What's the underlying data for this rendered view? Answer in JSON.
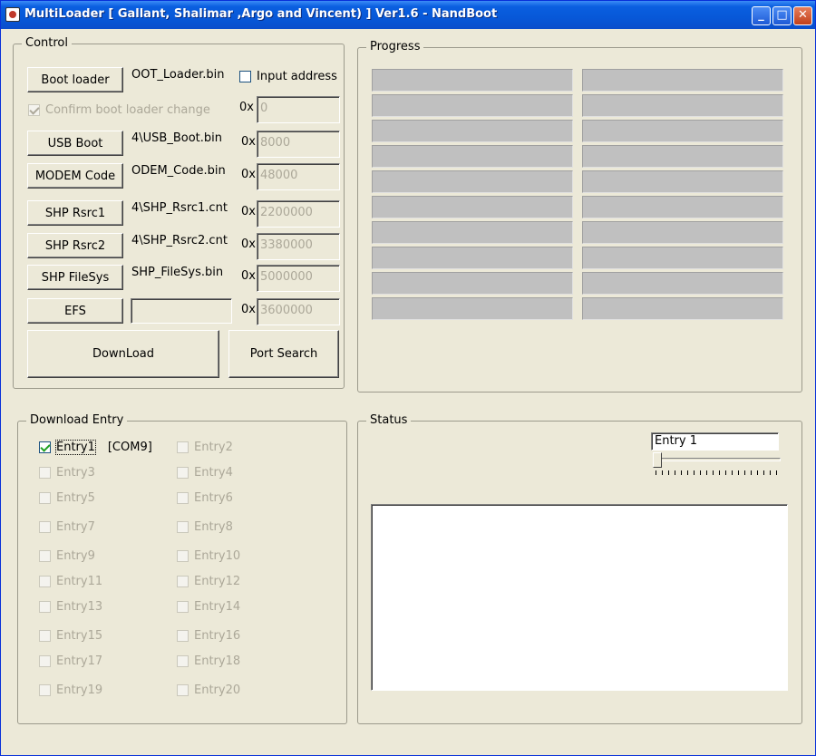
{
  "window": {
    "title": "MultiLoader [ Gallant, Shalimar ,Argo and Vincent) ] Ver1.6 - NandBoot",
    "minimize": "_",
    "maximize": "□",
    "close": "✕"
  },
  "control": {
    "label": "Control",
    "input_address_label": "Input address",
    "confirm_label": "Confirm boot loader change",
    "hex_prefix": "0x",
    "rows": [
      {
        "button": "Boot loader",
        "file": "OOT_Loader.bin",
        "addr": "0"
      },
      {
        "button": "USB Boot",
        "file": "4\\USB_Boot.bin",
        "addr": "8000"
      },
      {
        "button": "MODEM Code",
        "file": "ODEM_Code.bin",
        "addr": "48000"
      },
      {
        "button": "SHP Rsrc1",
        "file": "4\\SHP_Rsrc1.cnt",
        "addr": "2200000"
      },
      {
        "button": "SHP Rsrc2",
        "file": "4\\SHP_Rsrc2.cnt",
        "addr": "3380000"
      },
      {
        "button": "SHP FileSys",
        "file": "SHP_FileSys.bin",
        "addr": "5000000"
      },
      {
        "button": "EFS",
        "file": "",
        "addr": "3600000"
      }
    ],
    "download_label": "DownLoad",
    "port_search_label": "Port Search"
  },
  "progress": {
    "label": "Progress",
    "bar_count": 20
  },
  "download_entry": {
    "label": "Download Entry",
    "entries": [
      {
        "label": "Entry1",
        "port": "[COM9]",
        "checked": true,
        "enabled": true
      },
      {
        "label": "Entry2",
        "port": "",
        "checked": false,
        "enabled": false
      },
      {
        "label": "Entry3",
        "port": "",
        "checked": false,
        "enabled": false
      },
      {
        "label": "Entry4",
        "port": "",
        "checked": false,
        "enabled": false
      },
      {
        "label": "Entry5",
        "port": "",
        "checked": false,
        "enabled": false
      },
      {
        "label": "Entry6",
        "port": "",
        "checked": false,
        "enabled": false
      },
      {
        "label": "Entry7",
        "port": "",
        "checked": false,
        "enabled": false
      },
      {
        "label": "Entry8",
        "port": "",
        "checked": false,
        "enabled": false
      },
      {
        "label": "Entry9",
        "port": "",
        "checked": false,
        "enabled": false
      },
      {
        "label": "Entry10",
        "port": "",
        "checked": false,
        "enabled": false
      },
      {
        "label": "Entry11",
        "port": "",
        "checked": false,
        "enabled": false
      },
      {
        "label": "Entry12",
        "port": "",
        "checked": false,
        "enabled": false
      },
      {
        "label": "Entry13",
        "port": "",
        "checked": false,
        "enabled": false
      },
      {
        "label": "Entry14",
        "port": "",
        "checked": false,
        "enabled": false
      },
      {
        "label": "Entry15",
        "port": "",
        "checked": false,
        "enabled": false
      },
      {
        "label": "Entry16",
        "port": "",
        "checked": false,
        "enabled": false
      },
      {
        "label": "Entry17",
        "port": "",
        "checked": false,
        "enabled": false
      },
      {
        "label": "Entry18",
        "port": "",
        "checked": false,
        "enabled": false
      },
      {
        "label": "Entry19",
        "port": "",
        "checked": false,
        "enabled": false
      },
      {
        "label": "Entry20",
        "port": "",
        "checked": false,
        "enabled": false
      }
    ]
  },
  "status": {
    "label": "Status",
    "entry_value": "Entry 1",
    "log_text": ""
  }
}
